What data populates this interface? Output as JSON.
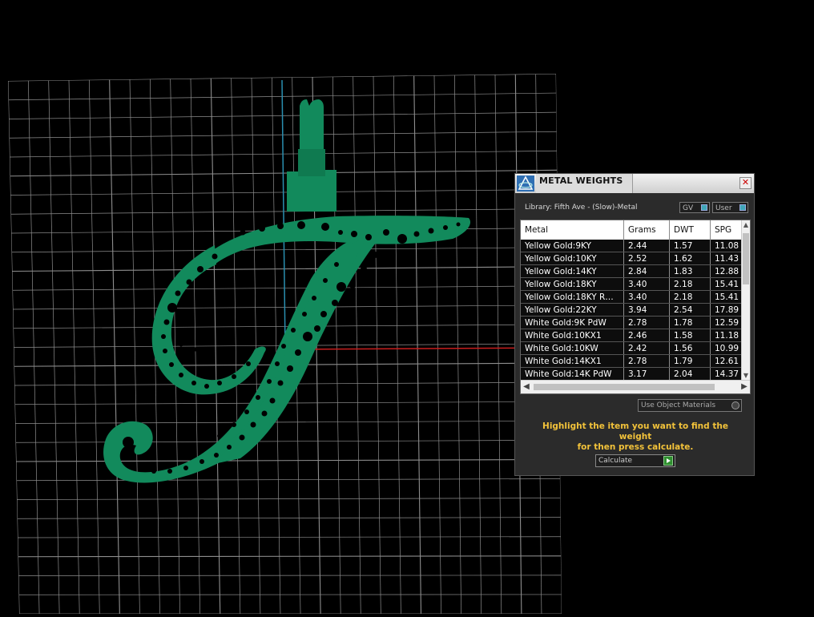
{
  "panel": {
    "title": "METAL WEIGHTS",
    "close_label": "✕",
    "library_label": "Library: Fifth Ave - (Slow)-Metal",
    "gv_label": "GV",
    "user_label": "User",
    "use_object_materials_label": "Use Object Materials",
    "hint_line1": "Highlight the item you want to find the weight",
    "hint_line2": "for then press calculate.",
    "calculate_label": "Calculate"
  },
  "table": {
    "columns": [
      "Metal",
      "Grams",
      "DWT",
      "SPG"
    ],
    "rows": [
      [
        "Yellow Gold:9KY",
        "2.44",
        "1.57",
        "11.08"
      ],
      [
        "Yellow Gold:10KY",
        "2.52",
        "1.62",
        "11.43"
      ],
      [
        "Yellow Gold:14KY",
        "2.84",
        "1.83",
        "12.88"
      ],
      [
        "Yellow Gold:18KY",
        "3.40",
        "2.18",
        "15.41"
      ],
      [
        "Yellow Gold:18KY R…",
        "3.40",
        "2.18",
        "15.41"
      ],
      [
        "Yellow Gold:22KY",
        "3.94",
        "2.54",
        "17.89"
      ],
      [
        "White Gold:9K PdW",
        "2.78",
        "1.78",
        "12.59"
      ],
      [
        "White Gold:10KX1",
        "2.46",
        "1.58",
        "11.18"
      ],
      [
        "White Gold:10KW",
        "2.42",
        "1.56",
        "10.99"
      ],
      [
        "White Gold:14KX1",
        "2.78",
        "1.79",
        "12.61"
      ],
      [
        "White Gold:14K PdW",
        "3.17",
        "2.04",
        "14.37"
      ]
    ]
  },
  "colors": {
    "model": "#128a5c",
    "grid": "#9c9c9c",
    "axis_x": "#c81e1e",
    "axis_y": "#2a8fb0",
    "hint": "#f2c23a"
  },
  "icons": [
    "app-logo-icon",
    "close-icon",
    "chevron-up-icon",
    "chevron-down-icon",
    "chevron-left-icon",
    "chevron-right-icon",
    "play-icon"
  ]
}
